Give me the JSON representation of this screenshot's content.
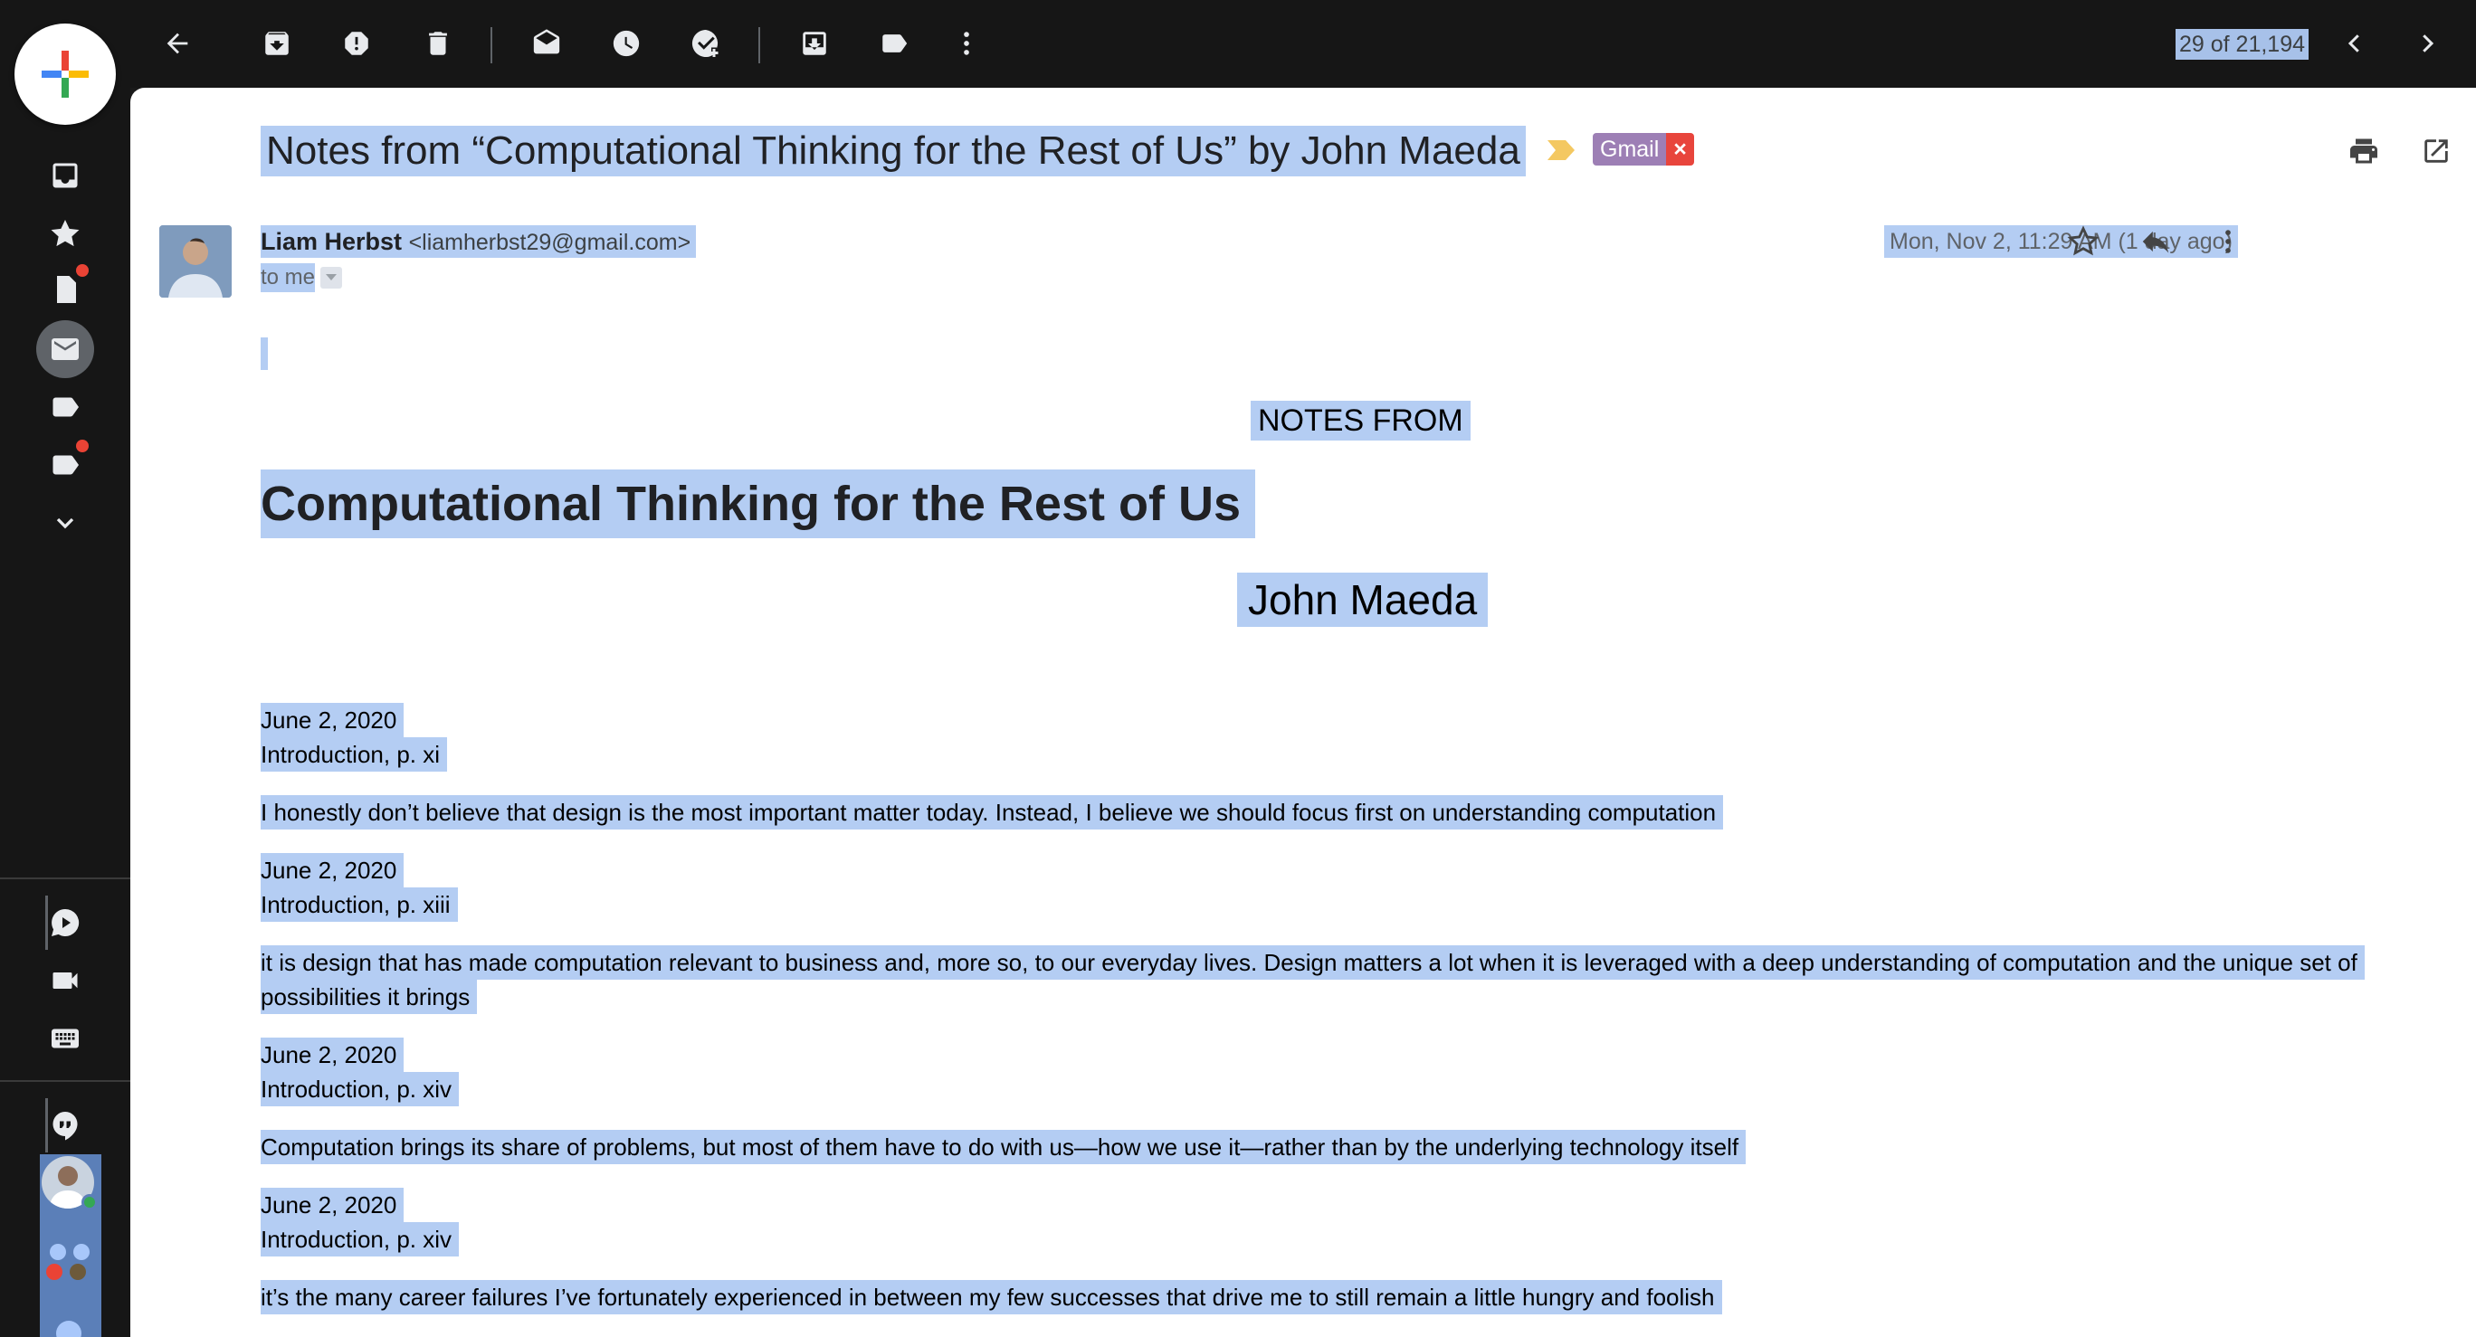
{
  "toolbar": {
    "counter": "29 of 21,194"
  },
  "email": {
    "subject": "Notes from “Computational Thinking for the Rest of Us” by John Maeda",
    "label": "Gmail",
    "label_remove": "×",
    "sender_name": "Liam Herbst",
    "sender_email": "<liamherbst29@gmail.com>",
    "to": "to me",
    "date": "Mon, Nov 2, 11:29 AM (1 day ago)"
  },
  "body": {
    "notes_from": "NOTES FROM",
    "book_title": "Computational Thinking for the Rest of Us",
    "book_author": "John Maeda",
    "notes": [
      {
        "date": "June 2, 2020",
        "location": "Introduction, p. xi",
        "text": "I honestly don’t believe that design is the most important matter today. Instead, I believe we should focus first on understanding computation"
      },
      {
        "date": "June 2, 2020",
        "location": "Introduction, p. xiii",
        "text_line1": "it is design that has made computation relevant to business and, more so, to our everyday lives. Design matters a lot when it is leveraged with a deep understanding of computation and the unique set of",
        "text_line2": "possibilities it brings"
      },
      {
        "date": "June 2, 2020",
        "location": "Introduction, p. xiv",
        "text": "Computation brings its share of problems, but most of them have to do with us—how we use it—rather than by the underlying technology itself"
      },
      {
        "date": "June 2, 2020",
        "location": "Introduction, p. xiv",
        "text": "it’s the many career failures I’ve fortunately experienced in between my few successes that drive me to still remain a little hungry and foolish"
      }
    ]
  },
  "icons": {
    "compose": "compose-plus-icon",
    "toolbar": [
      "back-arrow-icon",
      "archive-icon",
      "report-spam-icon",
      "delete-icon",
      "mark-unread-icon",
      "snooze-icon",
      "add-task-icon",
      "move-to-icon",
      "labels-icon",
      "more-vert-icon",
      "chevron-left-icon",
      "chevron-right-icon"
    ],
    "rail": [
      "inbox-icon",
      "starred-icon",
      "drafts-icon",
      "mail-icon",
      "label-icon",
      "label-icon-2",
      "expand-more-icon",
      "chat-icon",
      "meet-icon",
      "keyboard-icon",
      "hangouts-icon"
    ]
  },
  "colors": {
    "selection": "#b4cdf3",
    "label_bg": "#9d7fb5",
    "label_remove_bg": "#e8453c",
    "notification_dot": "#ea4335",
    "presence": "#34a853"
  }
}
